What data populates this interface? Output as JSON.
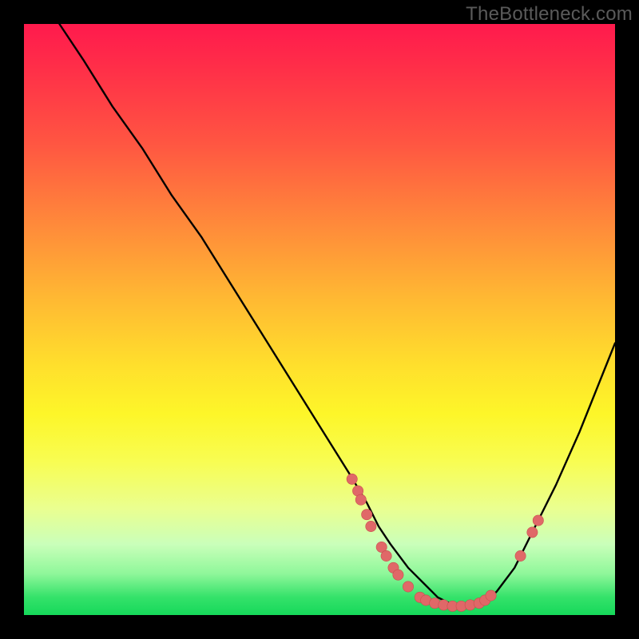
{
  "watermark": "TheBottleneck.com",
  "colors": {
    "background": "#000000",
    "curve": "#000000",
    "marker_fill": "#e06868",
    "marker_stroke": "#c94e4e"
  },
  "chart_data": {
    "type": "line",
    "title": "",
    "xlabel": "",
    "ylabel": "",
    "xlim": [
      0,
      100
    ],
    "ylim": [
      0,
      100
    ],
    "note": "No axis ticks or numeric labels are visible; x/y values are read off in percent of plot area (0–100 each), y increases upward.",
    "series": [
      {
        "name": "curve",
        "x": [
          6,
          10,
          15,
          20,
          25,
          30,
          35,
          40,
          45,
          50,
          55,
          58,
          60,
          62,
          65,
          68,
          70,
          72,
          75,
          78,
          80,
          83,
          86,
          90,
          94,
          98,
          100
        ],
        "y": [
          100,
          94,
          86,
          79,
          71,
          64,
          56,
          48,
          40,
          32,
          24,
          19,
          15,
          12,
          8,
          5,
          3,
          2,
          1.5,
          2,
          4,
          8,
          14,
          22,
          31,
          41,
          46
        ]
      }
    ],
    "markers": [
      {
        "x": 55.5,
        "y": 23.0
      },
      {
        "x": 56.5,
        "y": 21.0
      },
      {
        "x": 57.0,
        "y": 19.5
      },
      {
        "x": 58.0,
        "y": 17.0
      },
      {
        "x": 58.7,
        "y": 15.0
      },
      {
        "x": 60.5,
        "y": 11.5
      },
      {
        "x": 61.3,
        "y": 10.0
      },
      {
        "x": 62.5,
        "y": 8.0
      },
      {
        "x": 63.3,
        "y": 6.8
      },
      {
        "x": 65.0,
        "y": 4.8
      },
      {
        "x": 67.0,
        "y": 3.0
      },
      {
        "x": 68.0,
        "y": 2.5
      },
      {
        "x": 69.5,
        "y": 2.0
      },
      {
        "x": 71.0,
        "y": 1.7
      },
      {
        "x": 72.5,
        "y": 1.5
      },
      {
        "x": 74.0,
        "y": 1.5
      },
      {
        "x": 75.5,
        "y": 1.7
      },
      {
        "x": 77.0,
        "y": 2.0
      },
      {
        "x": 78.0,
        "y": 2.5
      },
      {
        "x": 79.0,
        "y": 3.3
      },
      {
        "x": 84.0,
        "y": 10.0
      },
      {
        "x": 86.0,
        "y": 14.0
      },
      {
        "x": 87.0,
        "y": 16.0
      }
    ],
    "marker_radius_pct": 0.9
  }
}
